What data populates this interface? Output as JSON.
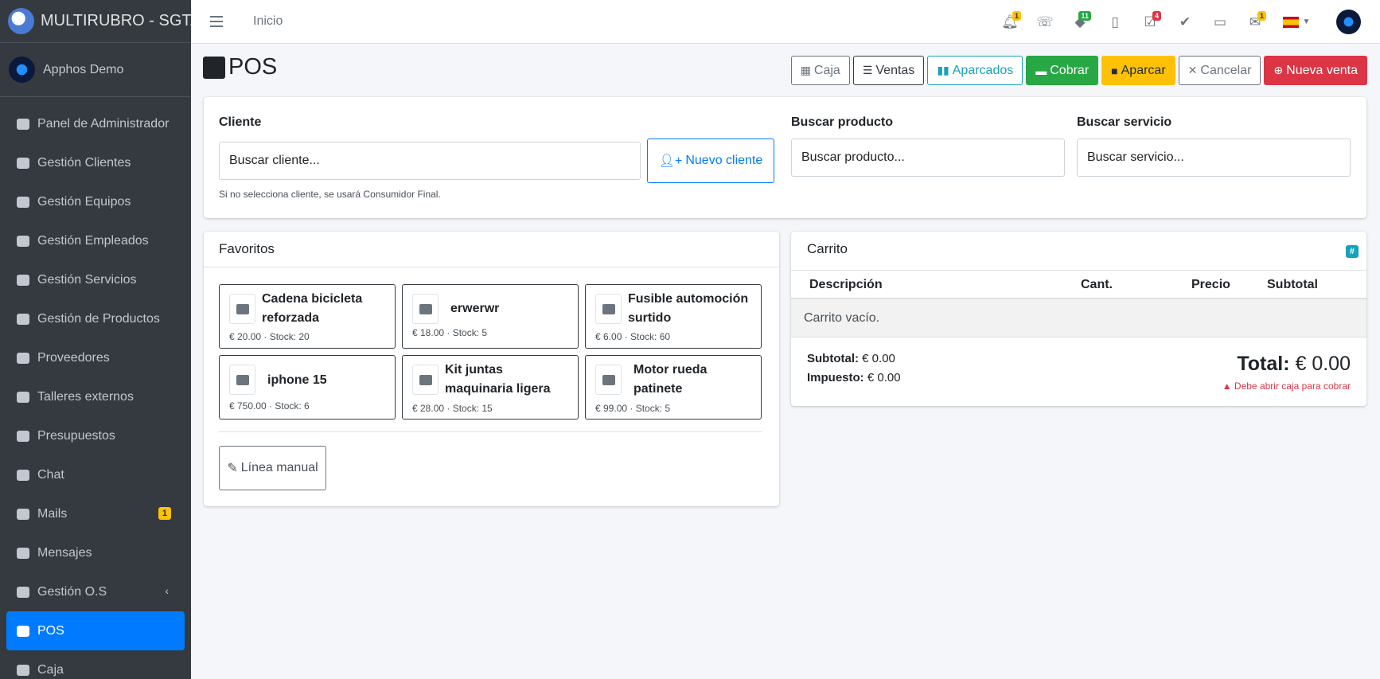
{
  "brand": {
    "title": "MULTIRUBRO - SGTA OS"
  },
  "user": {
    "name": "Apphos Demo"
  },
  "sidebar": {
    "items": [
      {
        "label": "Panel de Administrador"
      },
      {
        "label": "Gestión Clientes"
      },
      {
        "label": "Gestión Equipos"
      },
      {
        "label": "Gestión Empleados"
      },
      {
        "label": "Gestión Servicios"
      },
      {
        "label": "Gestión de Productos"
      },
      {
        "label": "Proveedores"
      },
      {
        "label": "Talleres externos"
      },
      {
        "label": "Presupuestos"
      },
      {
        "label": "Chat"
      },
      {
        "label": "Mails",
        "badge": "1"
      },
      {
        "label": "Mensajes"
      },
      {
        "label": "Gestión O.S",
        "caret": "‹"
      },
      {
        "label": "POS"
      },
      {
        "label": "Caja"
      }
    ]
  },
  "topbar": {
    "home_link": "Inicio",
    "badges": {
      "bell": "1",
      "tags": "11",
      "tasks": "4",
      "mail": "1"
    }
  },
  "page": {
    "title": "POS"
  },
  "actions": {
    "caja": "Caja",
    "ventas": "Ventas",
    "aparcados": "Aparcados",
    "cobrar": "Cobrar",
    "aparcar": "Aparcar",
    "cancelar": "Cancelar",
    "nueva_venta": "Nueva venta"
  },
  "search": {
    "cliente_label": "Cliente",
    "cliente_placeholder": "Buscar cliente...",
    "nuevo_cliente": "Nuevo cliente",
    "cliente_hint": "Si no selecciona cliente, se usará Consumidor Final.",
    "producto_label": "Buscar producto",
    "producto_placeholder": "Buscar producto...",
    "servicio_label": "Buscar servicio",
    "servicio_placeholder": "Buscar servicio..."
  },
  "favoritos": {
    "title": "Favoritos",
    "products": [
      {
        "name": "Cadena bicicleta reforzada",
        "meta": "€ 20.00 · Stock: 20"
      },
      {
        "name": "erwerwr",
        "meta": "€ 18.00 · Stock: 5"
      },
      {
        "name": "Fusible automoción surtido",
        "meta": "€ 6.00 · Stock: 60"
      },
      {
        "name": "iphone 15",
        "meta": "€ 750.00 · Stock: 6"
      },
      {
        "name": "Kit juntas maquinaria ligera",
        "meta": "€ 28.00 · Stock: 15"
      },
      {
        "name": "Motor rueda patinete",
        "meta": "€ 99.00 · Stock: 5"
      }
    ],
    "manual_line": "Línea manual"
  },
  "cart": {
    "title": "Carrito",
    "hash": "#",
    "columns": {
      "desc": "Descripción",
      "qty": "Cant.",
      "price": "Precio",
      "subtotal": "Subtotal"
    },
    "empty": "Carrito vacío.",
    "subtotal_label": "Subtotal:",
    "subtotal_value": "€ 0.00",
    "tax_label": "Impuesto:",
    "tax_value": "€ 0.00",
    "total_label": "Total:",
    "total_value": "€ 0.00",
    "warning": "Debe abrir caja para cobrar"
  },
  "colors": {
    "primary": "#007bff",
    "sidebar": "#343a40",
    "success": "#28a745",
    "warning": "#ffc107",
    "danger": "#dc3545",
    "info": "#17a2b8"
  }
}
